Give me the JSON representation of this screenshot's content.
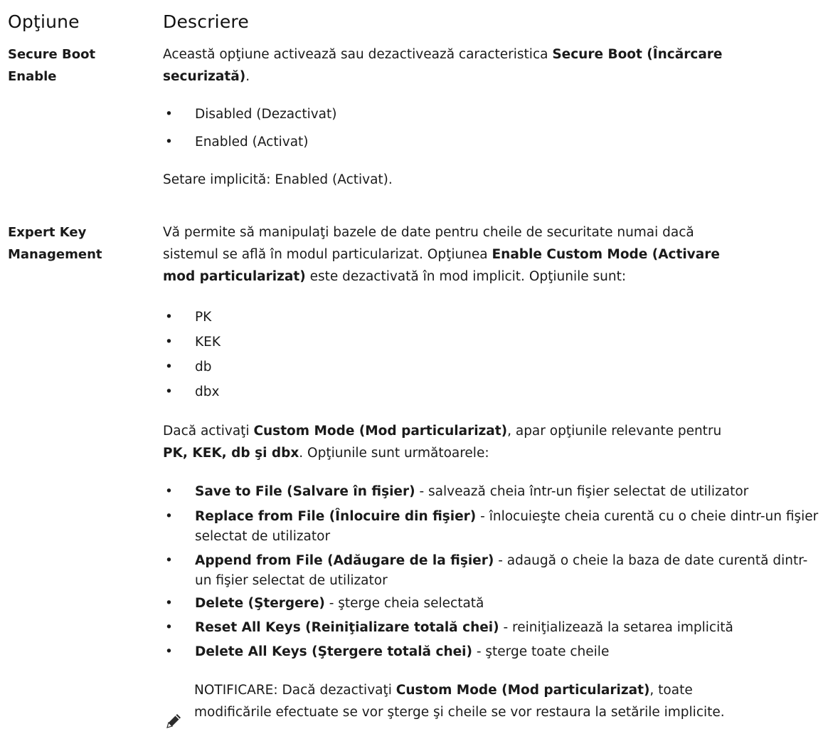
{
  "header": {
    "col1": "Opţiune",
    "col2": "Descriere"
  },
  "secure_boot": {
    "name_line1": "Secure Boot",
    "name_line2": "Enable",
    "desc_a": "Această opţiune activează sau dezactivează caracteristica ",
    "desc_b": "Secure Boot (Încărcare",
    "desc_c": "securizată)",
    "desc_d": ".",
    "options": [
      "Disabled (Dezactivat)",
      "Enabled (Activat)"
    ],
    "default": "Setare implicită: Enabled (Activat)."
  },
  "expert_key": {
    "name_line1": "Expert Key",
    "name_line2": "Management",
    "line1": "Vă permite să manipulaţi bazele de date pentru cheile de securitate numai dacă",
    "line2a": "sistemul se află în modul particularizat. Opţiunea ",
    "line2b": "Enable Custom Mode (Activare",
    "line3a": "mod particularizat)",
    "line3b": " este dezactivată în mod implicit. Opţiunile sunt:",
    "keys": [
      "PK",
      "KEK",
      "db",
      "dbx"
    ],
    "custom1a": "Dacă activaţi ",
    "custom1b": "Custom Mode (Mod particularizat)",
    "custom1c": ", apar opţiunile relevante pentru",
    "custom2a": "PK, KEK, db şi dbx",
    "custom2b": ". Opţiunile sunt următoarele:",
    "actions": [
      {
        "bold": "Save to File (Salvare în fişier)",
        "text": " - salvează cheia într-un fişier selectat de utilizator"
      },
      {
        "bold": "Replace from File (Înlocuire din fişier)",
        "text": " - înlocuieşte cheia curentă cu o cheie dintr-un fişier selectat de utilizator"
      },
      {
        "bold": "Append from File (Adăugare de la fişier)",
        "text": " - adaugă o cheie la baza de date curentă dintr-un fişier selectat de utilizator"
      },
      {
        "bold": "Delete (Ştergere)",
        "text": " - şterge cheia selectată"
      },
      {
        "bold": "Reset All Keys (Reiniţializare totală chei)",
        "text": " - reiniţializează la setarea implicită"
      },
      {
        "bold": "Delete All Keys (Ştergere totală chei)",
        "text": " - şterge toate cheile"
      }
    ],
    "note_label": "NOTIFICARE:",
    "note_a": " Dacă dezactivaţi ",
    "note_b": "Custom Mode (Mod particularizat)",
    "note_c": ", toate",
    "note_line2": "modificările efectuate se vor şterge şi cheile se vor restaura la setările implicite."
  },
  "icons": {
    "note": "pencil-note-icon"
  }
}
